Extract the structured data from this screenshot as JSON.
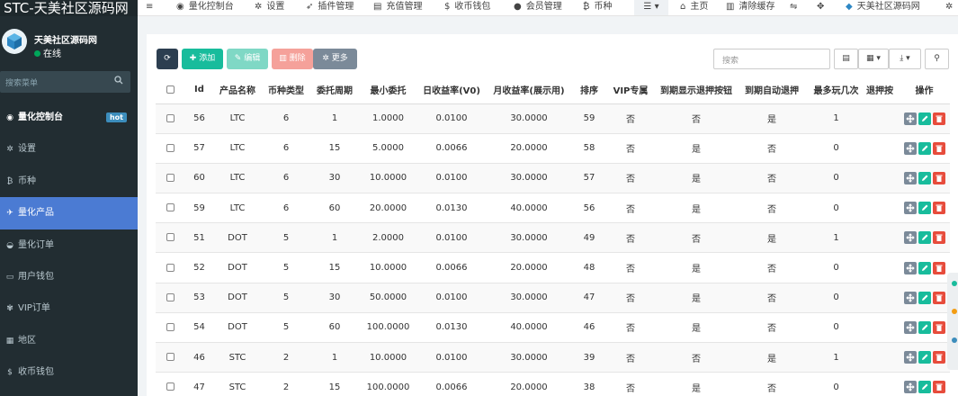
{
  "sidebar": {
    "brand": "STC-天美社区源码网",
    "user": {
      "name": "天美社区源码网",
      "status": "在线"
    },
    "search_placeholder": "搜索菜单",
    "items": [
      {
        "label": "量化控制台",
        "icon": "dashboard-icon",
        "badge": "hot",
        "bold": true
      },
      {
        "label": "设置",
        "icon": "gear-icon"
      },
      {
        "label": "币种",
        "icon": "bitcoin-icon"
      },
      {
        "label": "量化产品",
        "icon": "plane-icon",
        "active": true
      },
      {
        "label": "量化订单",
        "icon": "gauge-icon"
      },
      {
        "label": "用户钱包",
        "icon": "wallet-icon"
      },
      {
        "label": "VIP订单",
        "icon": "gift-icon"
      },
      {
        "label": "地区",
        "icon": "map-icon"
      },
      {
        "label": "收币钱包",
        "icon": "dollar-icon"
      }
    ]
  },
  "topbar": {
    "items": [
      {
        "label": "量化控制台",
        "icon": "dashboard-icon"
      },
      {
        "label": "设置",
        "icon": "gear-icon"
      },
      {
        "label": "插件管理",
        "icon": "rocket-icon"
      },
      {
        "label": "充值管理",
        "icon": "card-icon"
      },
      {
        "label": "收币钱包",
        "icon": "dollar-icon"
      },
      {
        "label": "会员管理",
        "icon": "user-icon"
      },
      {
        "label": "币种",
        "icon": "bitcoin-icon"
      },
      {
        "label": "主页",
        "icon": "home-icon"
      },
      {
        "label": "清除缓存",
        "icon": "trash-icon"
      },
      {
        "label": "天美社区源码网",
        "icon": "cube-icon"
      }
    ]
  },
  "toolbar": {
    "add_label": "添加",
    "edit_label": "编辑",
    "delete_label": "删除",
    "more_label": "更多",
    "search_placeholder": "搜索"
  },
  "table": {
    "headers": [
      "",
      "Id",
      "产品名称",
      "币种类型",
      "委托周期",
      "最小委托",
      "日收益率(V0)",
      "月收益率(展示用)",
      "排序",
      "VIP专属",
      "到期显示退押按钮",
      "到期自动退押",
      "最多玩几次",
      "退押按",
      "操作"
    ],
    "rows": [
      [
        "56",
        "LTC",
        "6",
        "1",
        "1.0000",
        "0.0100",
        "30.0000",
        "59",
        "否",
        "否",
        "是",
        "1"
      ],
      [
        "57",
        "LTC",
        "6",
        "15",
        "5.0000",
        "0.0066",
        "20.0000",
        "58",
        "否",
        "是",
        "否",
        "0"
      ],
      [
        "60",
        "LTC",
        "6",
        "30",
        "10.0000",
        "0.0100",
        "30.0000",
        "57",
        "否",
        "是",
        "否",
        "0"
      ],
      [
        "59",
        "LTC",
        "6",
        "60",
        "20.0000",
        "0.0130",
        "40.0000",
        "56",
        "否",
        "是",
        "否",
        "0"
      ],
      [
        "51",
        "DOT",
        "5",
        "1",
        "2.0000",
        "0.0100",
        "30.0000",
        "49",
        "否",
        "否",
        "是",
        "1"
      ],
      [
        "52",
        "DOT",
        "5",
        "15",
        "10.0000",
        "0.0066",
        "20.0000",
        "48",
        "否",
        "是",
        "否",
        "0"
      ],
      [
        "53",
        "DOT",
        "5",
        "30",
        "50.0000",
        "0.0100",
        "30.0000",
        "47",
        "否",
        "是",
        "否",
        "0"
      ],
      [
        "54",
        "DOT",
        "5",
        "60",
        "100.0000",
        "0.0130",
        "40.0000",
        "46",
        "否",
        "是",
        "否",
        "0"
      ],
      [
        "46",
        "STC",
        "2",
        "1",
        "10.0000",
        "0.0100",
        "30.0000",
        "39",
        "否",
        "否",
        "是",
        "1"
      ],
      [
        "47",
        "STC",
        "2",
        "15",
        "100.0000",
        "0.0066",
        "20.0000",
        "38",
        "否",
        "是",
        "否",
        "0"
      ]
    ]
  },
  "colors": {
    "sidebar_bg": "#222d32",
    "active": "#4b7bd3",
    "success": "#18bc9c",
    "danger": "#e74c3c",
    "primary_dark": "#2c3e50"
  }
}
